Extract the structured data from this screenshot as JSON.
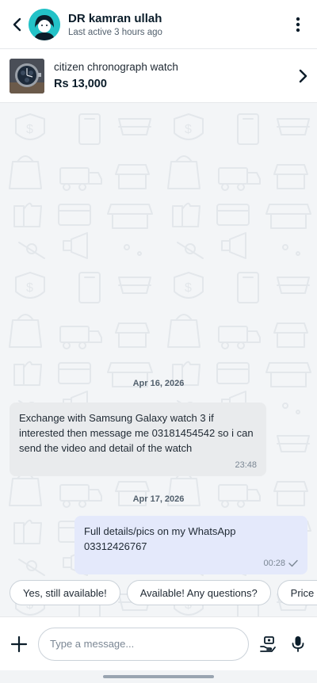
{
  "header": {
    "name": "DR kamran ullah",
    "status": "Last active 3 hours ago",
    "icons": {
      "back": "chevron-left-icon",
      "more": "more-vertical-icon"
    }
  },
  "product": {
    "name": "citizen chronograph watch",
    "price": "Rs 13,000",
    "icon": "chevron-right-icon"
  },
  "messages": [
    {
      "date": "Apr 16, 2026",
      "direction": "incoming",
      "text": "Exchange with Samsung Galaxy watch 3 if interested then message me 03181454542 so i can send the video and detail of the watch",
      "time": "23:48"
    },
    {
      "date": "Apr 17, 2026",
      "direction": "outgoing",
      "text": "Full details/pics on my WhatsApp 03312426767",
      "time": "00:28",
      "status_icon": "check-icon"
    }
  ],
  "quick_replies": [
    "Yes, still available!",
    "Available! Any questions?",
    "Price is"
  ],
  "composer": {
    "placeholder": "Type a message...",
    "icons": {
      "add": "plus-icon",
      "offer": "hand-coin-icon",
      "voice": "microphone-icon"
    }
  },
  "colors": {
    "accent": "#23c2c7",
    "incoming_bubble": "#e9ebed",
    "outgoing_bubble": "#e4e9fb",
    "background": "#f2f4f6"
  }
}
